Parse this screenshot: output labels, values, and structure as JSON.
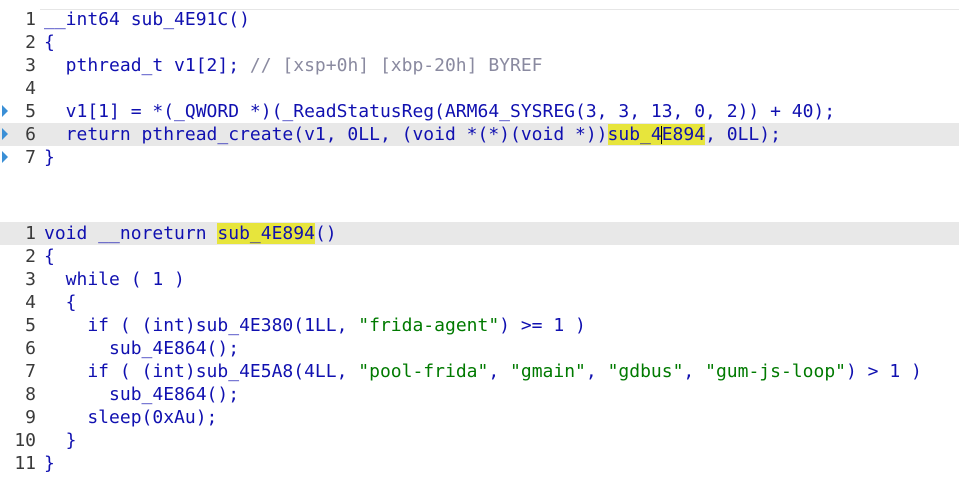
{
  "func1": {
    "lines": [
      {
        "num": "1",
        "parts": [
          [
            "plain",
            "__int64 sub_4E91C()"
          ]
        ]
      },
      {
        "num": "2",
        "parts": [
          [
            "plain",
            "{"
          ]
        ]
      },
      {
        "num": "3",
        "parts": [
          [
            "plain",
            "  pthread_t v1[2]; "
          ],
          [
            "gray",
            "// [xsp+0h] [xbp-20h] BYREF"
          ]
        ]
      },
      {
        "num": "4",
        "parts": []
      },
      {
        "num": "5",
        "parts": [
          [
            "plain",
            "  v1[1] = *(_QWORD *)(_ReadStatusReg(ARM64_SYSREG(3, 3, 13, 0, 2)) + 40);"
          ]
        ]
      },
      {
        "num": "6",
        "parts": [
          [
            "plain",
            "  return pthread_create(v1, 0LL, (void *(*)(void *))"
          ],
          [
            "sel",
            "sub_4"
          ],
          [
            "cursor",
            ""
          ],
          [
            "sel",
            "E894"
          ],
          [
            "plain",
            ", 0LL);"
          ]
        ]
      },
      {
        "num": "7",
        "parts": [
          [
            "plain",
            "}"
          ]
        ]
      }
    ]
  },
  "func2": {
    "lines": [
      {
        "num": "1",
        "parts": [
          [
            "plain",
            "void __noreturn "
          ],
          [
            "sel",
            "sub_4E894"
          ],
          [
            "plain",
            "()"
          ]
        ]
      },
      {
        "num": "2",
        "parts": [
          [
            "plain",
            "{"
          ]
        ]
      },
      {
        "num": "3",
        "parts": [
          [
            "plain",
            "  while ( 1 )"
          ]
        ]
      },
      {
        "num": "4",
        "parts": [
          [
            "plain",
            "  {"
          ]
        ]
      },
      {
        "num": "5",
        "parts": [
          [
            "plain",
            "    if ( (int)sub_4E380(1LL, "
          ],
          [
            "str",
            "\"frida-agent\""
          ],
          [
            "plain",
            ") >= 1 )"
          ]
        ]
      },
      {
        "num": "6",
        "parts": [
          [
            "plain",
            "      sub_4E864();"
          ]
        ]
      },
      {
        "num": "7",
        "parts": [
          [
            "plain",
            "    if ( (int)sub_4E5A8(4LL, "
          ],
          [
            "str",
            "\"pool-frida\""
          ],
          [
            "plain",
            ", "
          ],
          [
            "str",
            "\"gmain\""
          ],
          [
            "plain",
            ", "
          ],
          [
            "str",
            "\"gdbus\""
          ],
          [
            "plain",
            ", "
          ],
          [
            "str",
            "\"gum-js-loop\""
          ],
          [
            "plain",
            ") > 1 )"
          ]
        ]
      },
      {
        "num": "8",
        "parts": [
          [
            "plain",
            "      sub_4E864();"
          ]
        ]
      },
      {
        "num": "9",
        "parts": [
          [
            "plain",
            "    sleep(0xAu);"
          ]
        ]
      },
      {
        "num": "10",
        "parts": [
          [
            "plain",
            "  }"
          ]
        ]
      },
      {
        "num": "11",
        "parts": [
          [
            "plain",
            "}"
          ]
        ]
      }
    ]
  },
  "colors": {
    "code_text": "#1010b0",
    "comment": "#8a8aa0",
    "string": "#007a00",
    "selection": "#e7e53c",
    "current_line": "#e8e8e8",
    "marker": "#3a8fd6"
  }
}
